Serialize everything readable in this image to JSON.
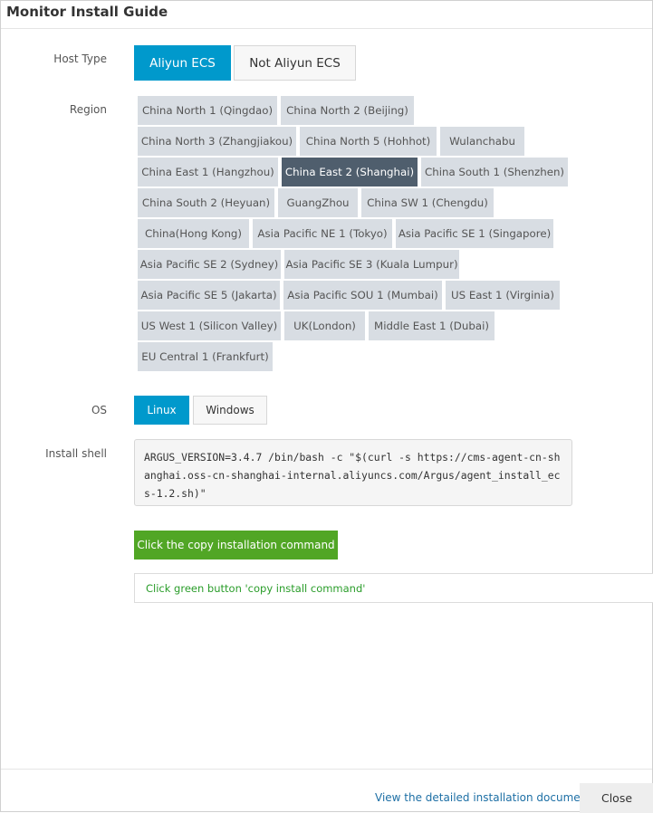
{
  "dialog": {
    "title": "Monitor Install Guide"
  },
  "host_type": {
    "label": "Host Type",
    "options": [
      "Aliyun ECS",
      "Not Aliyun ECS"
    ],
    "selected": "Aliyun ECS"
  },
  "region": {
    "label": "Region",
    "options": [
      "China North 1 (Qingdao)",
      "China North 2 (Beijing)",
      "China North 3 (Zhangjiakou)",
      "China North 5 (Hohhot)",
      "Wulanchabu",
      "China East 1 (Hangzhou)",
      "China East 2 (Shanghai)",
      "China South 1 (Shenzhen)",
      "China South 2 (Heyuan)",
      "GuangZhou",
      "China SW 1 (Chengdu)",
      "China(Hong Kong)",
      "Asia Pacific NE 1 (Tokyo)",
      "Asia Pacific SE 1 (Singapore)",
      "Asia Pacific SE 2 (Sydney)",
      "Asia Pacific SE 3 (Kuala Lumpur)",
      "Asia Pacific SE 5 (Jakarta)",
      "Asia Pacific SOU 1 (Mumbai)",
      "US East 1 (Virginia)",
      "US West 1 (Silicon Valley)",
      "UK(London)",
      "Middle East 1 (Dubai)",
      "EU Central 1 (Frankfurt)"
    ],
    "selected": "China East 2 (Shanghai)"
  },
  "os": {
    "label": "OS",
    "options": [
      "Linux",
      "Windows"
    ],
    "selected": "Linux"
  },
  "install_shell": {
    "label": "Install shell",
    "command": "ARGUS_VERSION=3.4.7 /bin/bash -c \"$(curl -s https://cms-agent-cn-shanghai.oss-cn-shanghai-internal.aliyuncs.com/Argus/agent_install_ecs-1.2.sh)\""
  },
  "copy_button": {
    "label": "Click the copy installation command"
  },
  "hint": {
    "text": "Click green button 'copy install command'"
  },
  "footer": {
    "doc_link": "View the detailed installation documents",
    "close_label": "Close"
  },
  "colors": {
    "accent": "#0099cc",
    "region_selected": "#4f5e6d",
    "region_default": "#d8dde3",
    "copy_button": "#51a625",
    "hint_text": "#2a9d2a",
    "link": "#1d6fa5"
  }
}
